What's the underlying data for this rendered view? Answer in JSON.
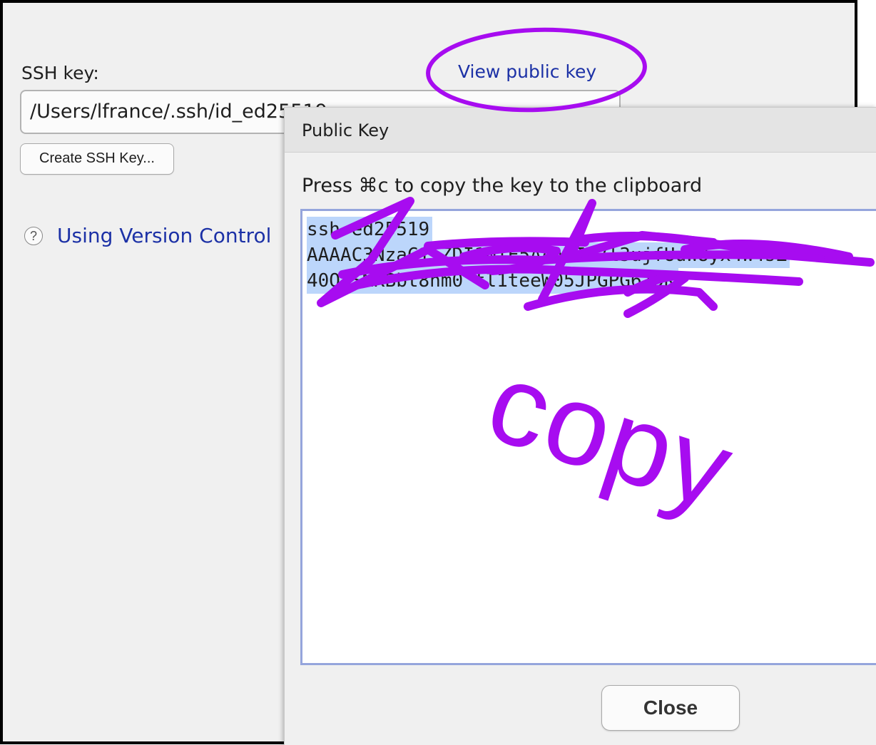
{
  "settings": {
    "ssh_key_label": "SSH key:",
    "ssh_key_path": "/Users/lfrance/.ssh/id_ed25519",
    "create_key_button": "Create SSH Key...",
    "view_public_key_link": "View public key",
    "help_link": "Using Version Control"
  },
  "dialog": {
    "title": "Public Key",
    "instructions": "Press ⌘c to copy the key to the clipboard",
    "key_lines": [
      "ssh-ed25519",
      "AAAAC3NzaC1lZDI1NTE5AAAAIG7l3ujfUuW8yx4W4sZ",
      "40QtSMKBbt8nm0 tl1teeW05JPGPG6ZDK"
    ],
    "close_button": "Close"
  },
  "annotation": {
    "text": "copy",
    "color": "#a70cf0"
  },
  "colors": {
    "link": "#1c31a6",
    "selection": "#bcd6fb",
    "key_area_border": "#95a5dc"
  }
}
